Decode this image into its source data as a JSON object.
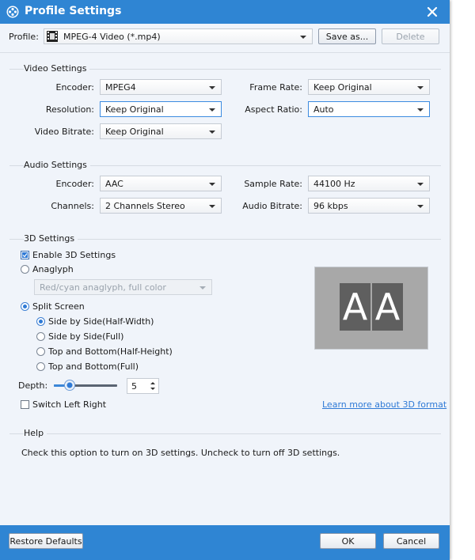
{
  "window": {
    "title": "Profile Settings"
  },
  "profile": {
    "label": "Profile:",
    "value": "MPEG-4 Video (*.mp4)",
    "save_as": "Save as...",
    "delete": "Delete"
  },
  "video": {
    "title": "Video Settings",
    "encoder_label": "Encoder:",
    "encoder_value": "MPEG4",
    "resolution_label": "Resolution:",
    "resolution_value": "Keep Original",
    "bitrate_label": "Video Bitrate:",
    "bitrate_value": "Keep Original",
    "framerate_label": "Frame Rate:",
    "framerate_value": "Keep Original",
    "aspect_label": "Aspect Ratio:",
    "aspect_value": "Auto"
  },
  "audio": {
    "title": "Audio Settings",
    "encoder_label": "Encoder:",
    "encoder_value": "AAC",
    "channels_label": "Channels:",
    "channels_value": "2 Channels Stereo",
    "samplerate_label": "Sample Rate:",
    "samplerate_value": "44100 Hz",
    "bitrate_label": "Audio Bitrate:",
    "bitrate_value": "96 kbps"
  },
  "threed": {
    "title": "3D Settings",
    "enable_label": "Enable 3D Settings",
    "anaglyph_label": "Anaglyph",
    "anaglyph_value": "Red/cyan anaglyph, full color",
    "split_label": "Split Screen",
    "options": [
      "Side by Side(Half-Width)",
      "Side by Side(Full)",
      "Top and Bottom(Half-Height)",
      "Top and Bottom(Full)"
    ],
    "depth_label": "Depth:",
    "depth_value": "5",
    "depth_level": 0.25,
    "switch_label": "Switch Left Right",
    "learn_more": "Learn more about 3D format",
    "preview_left": "A",
    "preview_right": "A"
  },
  "help": {
    "title": "Help",
    "text": "Check this option to turn on 3D settings. Uncheck to turn off 3D settings."
  },
  "footer": {
    "restore": "Restore Defaults",
    "ok": "OK",
    "cancel": "Cancel"
  },
  "colors": {
    "accent": "#2f85d3",
    "link": "#2f7ad6",
    "background": "#f0f4fa"
  }
}
